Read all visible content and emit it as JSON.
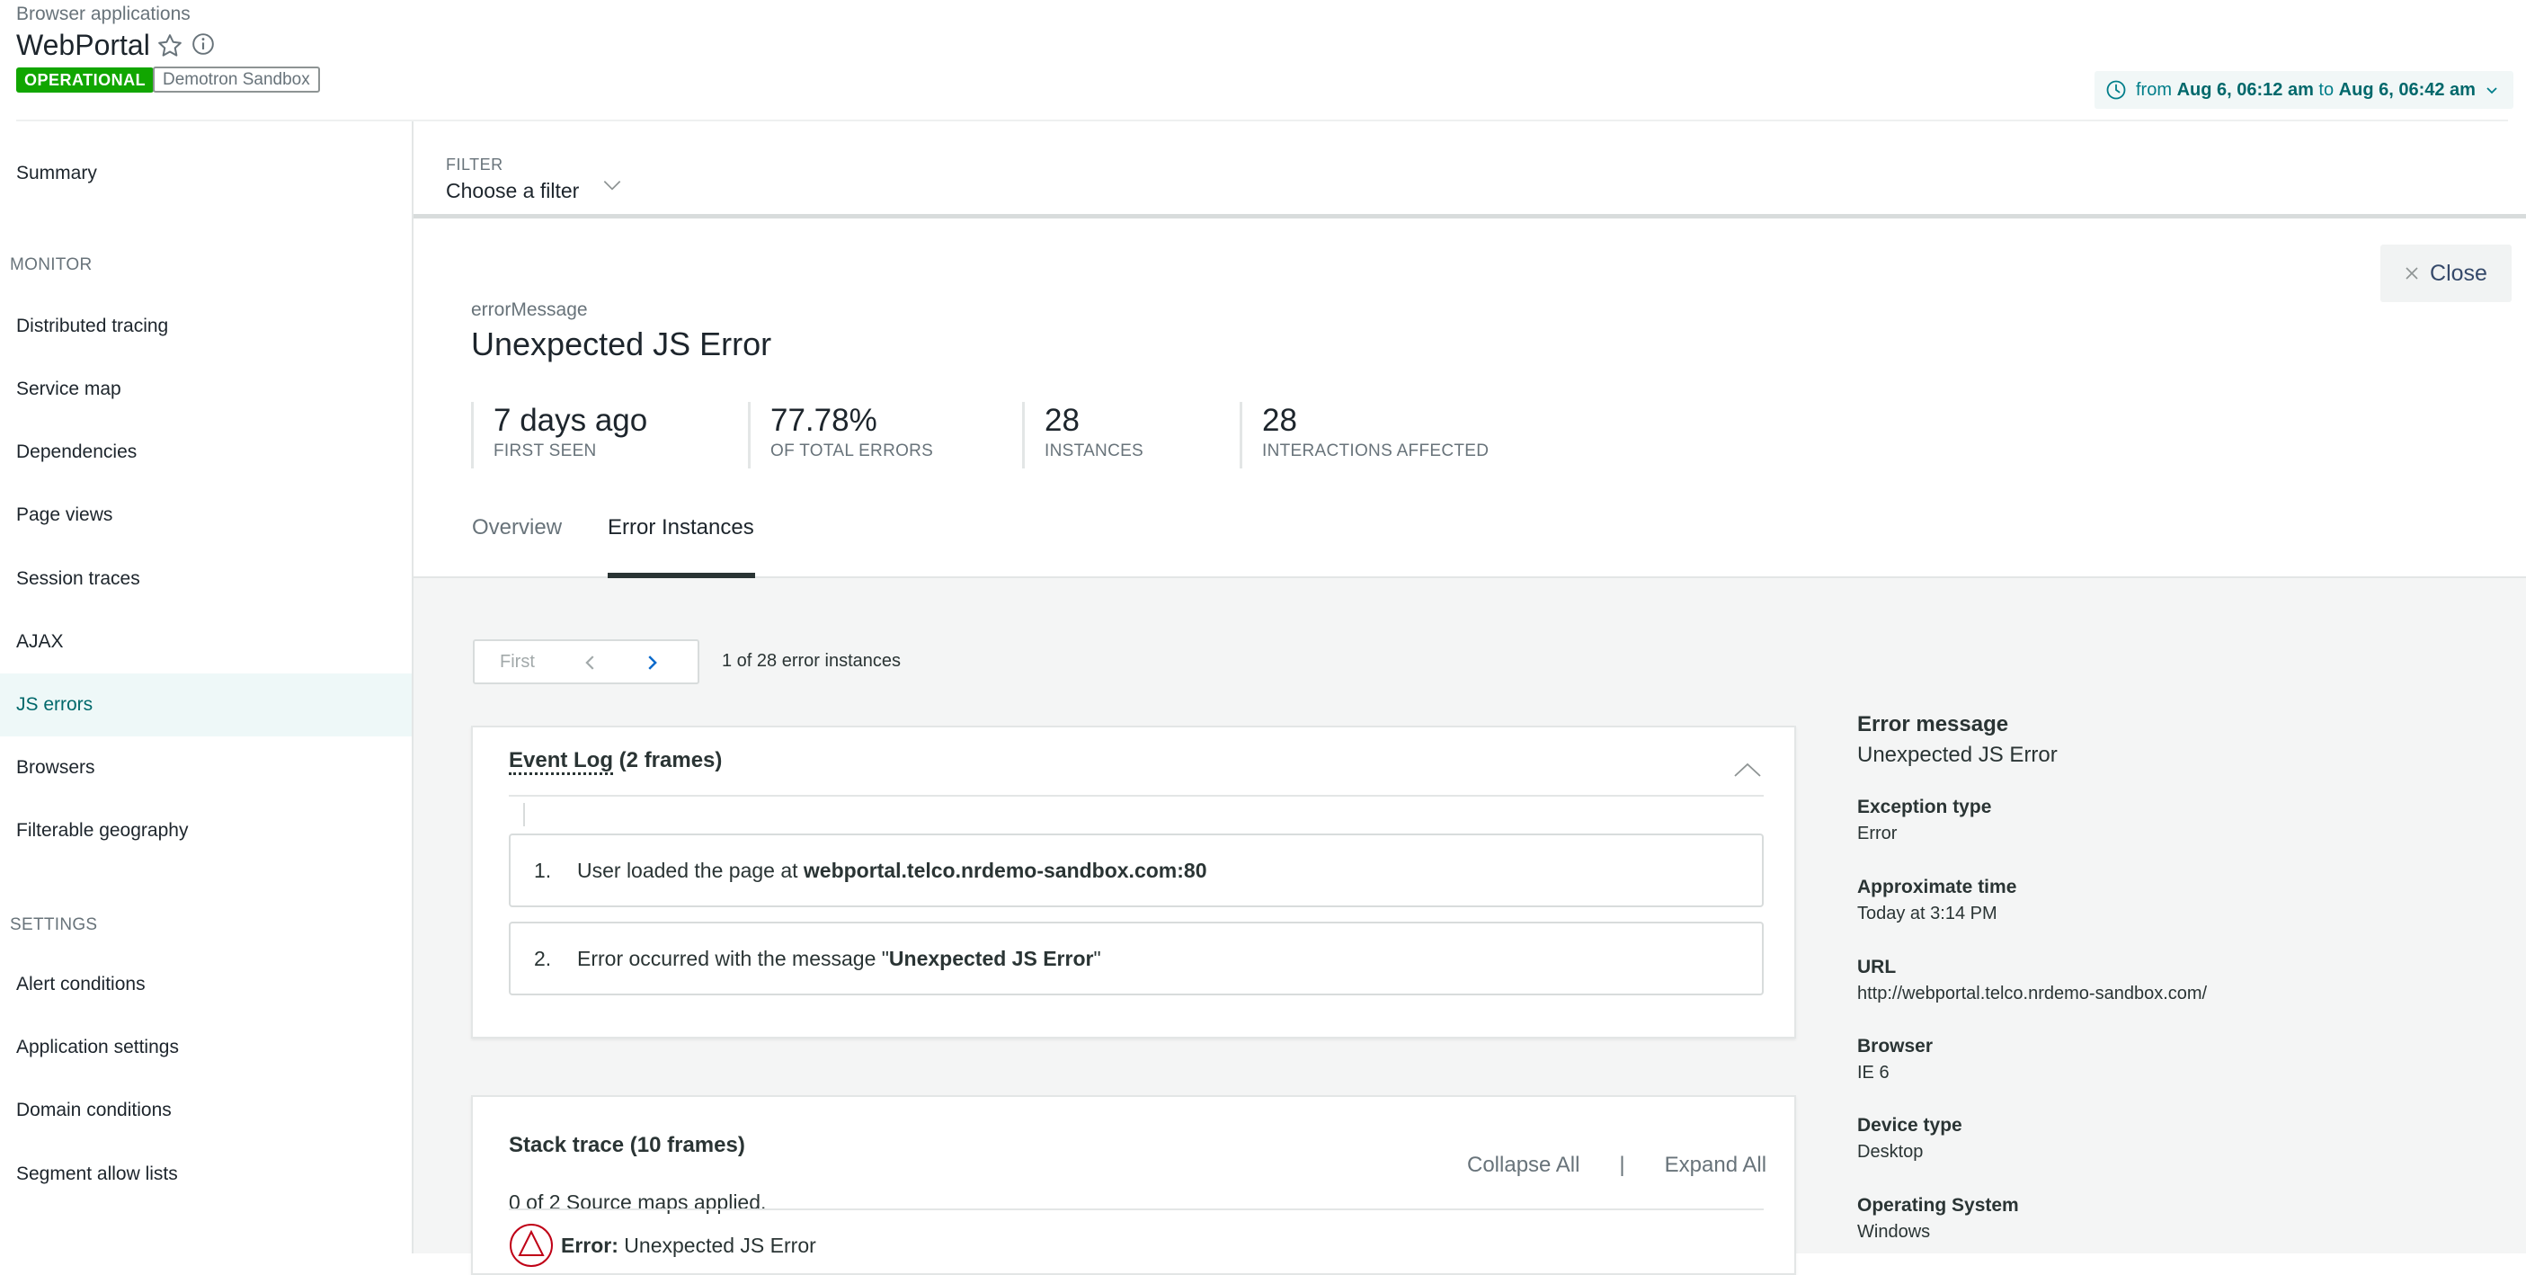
{
  "header": {
    "breadcrumb": "Browser applications",
    "app_title": "WebPortal",
    "status_badge": "OPERATIONAL",
    "account_badge": "Demotron Sandbox",
    "time_range": {
      "from_word": "from",
      "from": "Aug 6, 06:12 am",
      "to_word": "to",
      "to": "Aug 6, 06:42 am"
    },
    "colors": {
      "operational": "#11a600",
      "accent": "#007e8a"
    }
  },
  "sidebar": {
    "summary": "Summary",
    "monitor_heading": "MONITOR",
    "monitor_items": [
      {
        "label": "Distributed tracing"
      },
      {
        "label": "Service map"
      },
      {
        "label": "Dependencies"
      },
      {
        "label": "Page views"
      },
      {
        "label": "Session traces"
      },
      {
        "label": "AJAX"
      },
      {
        "label": "JS errors",
        "active": true
      },
      {
        "label": "Browsers"
      },
      {
        "label": "Filterable geography"
      }
    ],
    "settings_heading": "SETTINGS",
    "settings_items": [
      {
        "label": "Alert conditions"
      },
      {
        "label": "Application settings"
      },
      {
        "label": "Domain conditions"
      },
      {
        "label": "Segment allow lists"
      }
    ]
  },
  "filter": {
    "label": "FILTER",
    "placeholder": "Choose a filter"
  },
  "detail": {
    "close_label": "Close",
    "error_key": "errorMessage",
    "error_title": "Unexpected JS Error",
    "stats": [
      {
        "value": "7 days ago",
        "label": "FIRST SEEN"
      },
      {
        "value": "77.78%",
        "label": "OF TOTAL ERRORS"
      },
      {
        "value": "28",
        "label": "INSTANCES"
      },
      {
        "value": "28",
        "label": "INTERACTIONS AFFECTED"
      }
    ],
    "tabs": [
      {
        "label": "Overview"
      },
      {
        "label": "Error Instances",
        "active": true
      }
    ],
    "pager": {
      "first": "First",
      "count_text": "1 of 28 error instances"
    },
    "event_log": {
      "title_main": "Event Log",
      "title_suffix": " (2 frames)",
      "events": [
        {
          "num": "1.",
          "text": "User loaded the page at ",
          "bold": "webportal.telco.nrdemo-sandbox.com:80",
          "tail": ""
        },
        {
          "num": "2.",
          "text": "Error occurred with the message \"",
          "bold": "Unexpected JS Error",
          "tail": "\""
        }
      ]
    },
    "stack_trace": {
      "title": "Stack trace (10 frames)",
      "subtitle": "0 of 2 Source maps applied.",
      "collapse_all": "Collapse All",
      "separator": "|",
      "expand_all": "Expand All",
      "error_label": "Error:",
      "error_text": " Unexpected JS Error"
    },
    "meta": [
      {
        "key": "Error message",
        "value": "Unexpected JS Error"
      },
      {
        "key": "Exception type",
        "value": "Error"
      },
      {
        "key": "Approximate time",
        "value": "Today at 3:14 PM"
      },
      {
        "key": "URL",
        "value": "http://webportal.telco.nrdemo-sandbox.com/"
      },
      {
        "key": "Browser",
        "value": "IE 6"
      },
      {
        "key": "Device type",
        "value": "Desktop"
      },
      {
        "key": "Operating System",
        "value": "Windows"
      }
    ]
  }
}
